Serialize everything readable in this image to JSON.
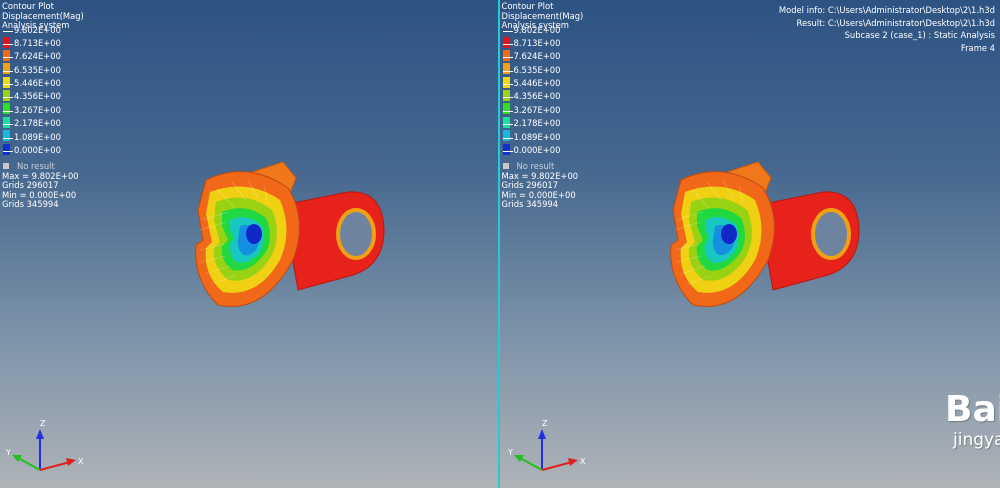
{
  "legend": {
    "title": "Contour Plot",
    "type": "Displacement(Mag)",
    "system": "Analysis system",
    "levels": [
      "9.802E+00",
      "8.713E+00",
      "7.624E+00",
      "6.535E+00",
      "5.446E+00",
      "4.356E+00",
      "3.267E+00",
      "2.178E+00",
      "1.089E+00",
      "0.000E+00"
    ],
    "colors": [
      "#e8101a",
      "#f56b12",
      "#f5a014",
      "#f0d80e",
      "#9ad410",
      "#2ee020",
      "#18e0a0",
      "#15b9e0",
      "#1030d0"
    ],
    "no_result": "No result",
    "max": "Max = 9.802E+00",
    "grids_max": "Grids 296017",
    "min": "Min = 0.000E+00",
    "grids_min": "Grids 345994"
  },
  "info": {
    "model": "Model info: C:\\Users\\Administrator\\Desktop\\2\\1.h3d",
    "result": "Result: C:\\Users\\Administrator\\Desktop\\2\\1.h3d",
    "subcase": "Subcase 2 (case_1) : Static Analysis",
    "frame": "Frame 4"
  },
  "triad": {
    "x": "X",
    "y": "Y",
    "z": "Z"
  },
  "watermark": {
    "brand": "Baidu 经验",
    "url": "jingyan.baidu.com"
  }
}
